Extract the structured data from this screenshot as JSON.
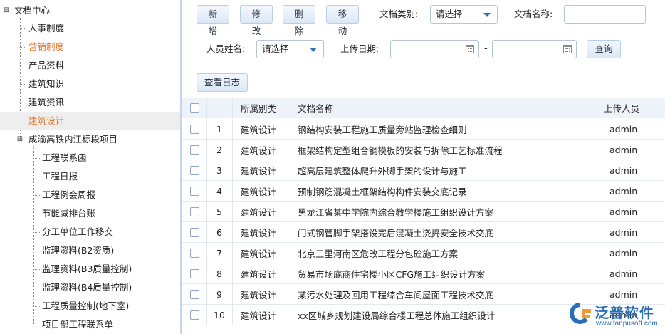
{
  "tree": {
    "root": "文档中心",
    "items": [
      {
        "label": "人事制度",
        "state": ""
      },
      {
        "label": "营销制度",
        "state": "active"
      },
      {
        "label": "产品资料",
        "state": ""
      },
      {
        "label": "建筑知识",
        "state": ""
      },
      {
        "label": "建筑资讯",
        "state": ""
      },
      {
        "label": "建筑设计",
        "state": "active selected"
      }
    ],
    "project": {
      "label": "成渝高铁内江标段项目",
      "children": [
        "工程联系函",
        "工程日报",
        "工程例会周报",
        "节能减排台账",
        "分工单位工作移交",
        "监理资料(B2资质)",
        "监理资料(B3质量控制)",
        "监理资料(B4质量控制)",
        "工程质量控制(地下室)",
        "项目部工程联系单"
      ]
    }
  },
  "toolbar": {
    "add": "新增",
    "edit": "修改",
    "delete": "删除",
    "move": "移动",
    "view_log": "查看日志",
    "query": "查询"
  },
  "filters": {
    "doc_type_label": "文档类别:",
    "doc_type_value": "请选择",
    "doc_name_label": "文档名称:",
    "doc_name_value": "",
    "person_label": "人员姓名:",
    "person_value": "请选择",
    "upload_date_label": "上传日期:",
    "date_from": "",
    "date_to": "",
    "range_sep": "-"
  },
  "grid": {
    "columns": {
      "category": "所属别类",
      "name": "文档名称",
      "uploader": "上传人员"
    },
    "rows": [
      {
        "no": "1",
        "category": "建筑设计",
        "name": "钢结构安装工程施工质量旁站监理检查细则",
        "uploader": "admin"
      },
      {
        "no": "2",
        "category": "建筑设计",
        "name": "框架结构定型组合钢模板的安装与拆除工艺标准流程",
        "uploader": "admin"
      },
      {
        "no": "3",
        "category": "建筑设计",
        "name": "超高层建筑整体爬升外脚手架的设计与施工",
        "uploader": "admin"
      },
      {
        "no": "4",
        "category": "建筑设计",
        "name": "预制钢筋混凝土框架结构构件安装交底记录",
        "uploader": "admin"
      },
      {
        "no": "5",
        "category": "建筑设计",
        "name": "黑龙江省某中学院内综合教学楼施工组织设计方案",
        "uploader": "admin"
      },
      {
        "no": "6",
        "category": "建筑设计",
        "name": "门式钢管脚手架搭设完后混凝土浇捣安全技术交底",
        "uploader": "admin"
      },
      {
        "no": "7",
        "category": "建筑设计",
        "name": "北京三里河南区危改工程分包砼施工方案",
        "uploader": "admin"
      },
      {
        "no": "8",
        "category": "建筑设计",
        "name": "贸易市场底商住宅楼小区CFG施工组织设计方案",
        "uploader": "admin"
      },
      {
        "no": "9",
        "category": "建筑设计",
        "name": "某污水处理及回用工程综合车间屋面工程技术交底",
        "uploader": "admin"
      },
      {
        "no": "10",
        "category": "建筑设计",
        "name": "xx区城乡规划建设局综合楼工程总体施工组织设计",
        "uploader": "admin"
      }
    ]
  },
  "watermark": {
    "text": "泛普软件",
    "url": "www.fanpusoft.com",
    "mark_icon": "fanpu-logo-icon"
  },
  "colors": {
    "accent": "#2c6fb6",
    "active_text": "#e8772e",
    "header_bg": "#eef3fa",
    "selected_bg": "#eeeeee"
  }
}
